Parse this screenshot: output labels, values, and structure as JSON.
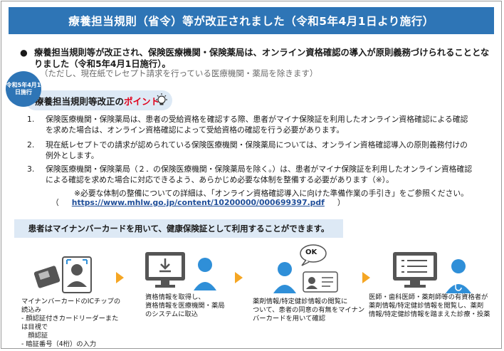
{
  "title": "療養担当規則（省令）等が改正されました（令和5年4月1日より施行）",
  "bullet": {
    "dot": "●",
    "text": "療養担当規則等が改正され、保険医療機関・保険薬局は、オンライン資格確認の導入が原則義務づけられることとなりました（令和5年4月1日施行）。",
    "note": "（ただし、現在紙でレセプト請求を行っている医療機関・薬局を除きます）"
  },
  "stamp": "令和5年4月1日施行",
  "point": {
    "prefix": "療養担当規則等改正の",
    "highlight": "ポイント"
  },
  "items": [
    {
      "num": "1.",
      "text": "保険医療機関・保険薬局は、患者の受給資格を確認する際、患者がマイナ保険証を利用したオンライン資格確認による確認を求めた場合は、オンライン資格確認によって受給資格の確認を行う必要があります。"
    },
    {
      "num": "2.",
      "text": "現在紙レセプトでの請求が認められている保険医療機関・保険薬局については、オンライン資格確認導入の原則義務付けの例外とします。"
    },
    {
      "num": "3.",
      "text": "保険医療機関・保険薬局（２．の保険医療機関・保険薬局を除く。）は、患者がマイナ保険証を利用したオンライン資格確認による確認を求めた場合に対応できるよう、あらかじめ必要な体制を整備する必要があります（※）。"
    }
  ],
  "note": {
    "text": "※必要な体制の整備についての詳細は、「オンライン資格確認導入に向けた準備作業の手引き」をご参照ください。",
    "open": "（",
    "url": "https://www.mhlw.go.jp/content/10200000/000699397.pdf",
    "close": "）"
  },
  "caption": "患者はマイナンバーカードを用いて、健康保険証として利用することができます。",
  "steps": [
    {
      "lines": [
        "マイナンバーカードのICチップの読込み",
        "- 顔認証付きカードリーダーまたは目視で",
        "　顔認証",
        "- 暗証番号（4桁）の入力"
      ]
    },
    {
      "lines": [
        "資格情報を取得し、",
        "資格情報を医療機関・薬局",
        "のシステムに取込"
      ]
    },
    {
      "lines": [
        "薬剤情報/特定健診情報の閲覧に",
        "ついて、患者の同意の有無をマイナン",
        "バーカードを用いて確認"
      ]
    },
    {
      "lines": [
        "医師・歯科医師・薬剤師等の有資格者が",
        "薬剤情報/特定健診情報を閲覧し、薬剤",
        "情報/特定健診情報を踏まえた診療・投薬"
      ]
    }
  ],
  "ok_label": "OK",
  "colors": {
    "primary": "#2e75b6",
    "light": "#dde9f5",
    "accent_red": "#e0001b",
    "arrow": "#f5a623",
    "icon_blue": "#2f8fd8"
  },
  "icons": [
    "lightbulb-icon",
    "id-card-reader-icon",
    "computer-download-icon",
    "person-icon",
    "speech-bubble-icon",
    "monitor-list-icon",
    "doctor-icon"
  ]
}
